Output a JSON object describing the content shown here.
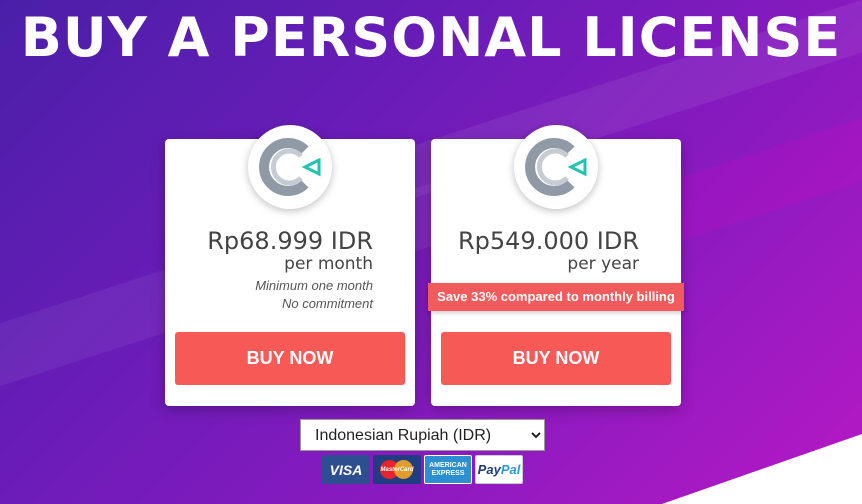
{
  "header": {
    "title": "BUY A PERSONAL LICENSE"
  },
  "plans": [
    {
      "price": "Rp68.999 IDR",
      "period": "per month",
      "notes": [
        "Minimum one month",
        "No commitment"
      ],
      "buy_label": "BUY NOW"
    },
    {
      "price": "Rp549.000 IDR",
      "period": "per year",
      "banner": "Save 33% compared to monthly billing",
      "buy_label": "BUY NOW"
    }
  ],
  "currency": {
    "selected": "Indonesian Rupiah (IDR)",
    "options": [
      "Indonesian Rupiah (IDR)"
    ]
  },
  "payment_methods": {
    "visa": "VISA",
    "mastercard": "MasterCard",
    "amex_line1": "AMERICAN",
    "amex_line2": "EXPRESS",
    "paypal_1": "Pay",
    "paypal_2": "Pal"
  },
  "colors": {
    "accent": "#f75a56",
    "logo_gray": "#8f9aa6",
    "logo_teal": "#22c3b0"
  },
  "icons": {
    "product_logo": "ccleaner-logo-icon"
  }
}
